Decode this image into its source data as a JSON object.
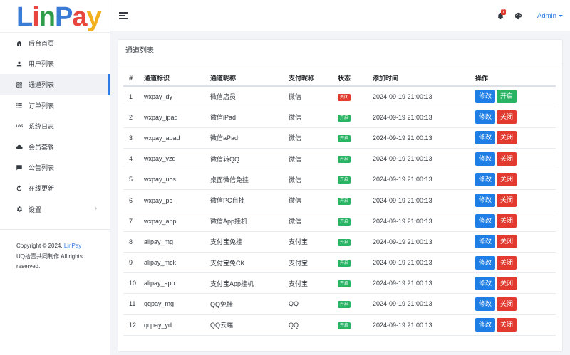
{
  "logo": {
    "letters": [
      "L",
      "i",
      "n",
      "P",
      "a",
      "y"
    ],
    "colors": [
      "#3a7bd5",
      "#e8453c",
      "#2e9e4a",
      "#3a7bd5",
      "#e8453c",
      "#f2b01e"
    ]
  },
  "sidebar": {
    "items": [
      {
        "label": "后台首页",
        "icon": "home-icon"
      },
      {
        "label": "用户列表",
        "icon": "user-icon"
      },
      {
        "label": "通道列表",
        "icon": "qrcode-icon",
        "active": true
      },
      {
        "label": "订单列表",
        "icon": "list-icon"
      },
      {
        "label": "系统日志",
        "icon": "log-icon"
      },
      {
        "label": "会员套餐",
        "icon": "cloud-icon"
      },
      {
        "label": "公告列表",
        "icon": "comment-icon"
      },
      {
        "label": "在线更新",
        "icon": "refresh-icon"
      },
      {
        "label": "设置",
        "icon": "gear-icon",
        "has_caret": true
      }
    ],
    "footer": {
      "copyright": "Copyright © 2024.",
      "brand": "LinPay",
      "line2": "UQ拾壹共同制作 All rights",
      "line3": "reserved."
    }
  },
  "topbar": {
    "notification_count": "7",
    "admin_label": "Admin"
  },
  "card": {
    "title": "通道列表"
  },
  "table": {
    "headers": [
      "#",
      "通道标识",
      "通道昵称",
      "支付昵称",
      "状态",
      "添加时间",
      "操作"
    ],
    "rows": [
      {
        "id": "1",
        "key": "wxpay_dy",
        "name": "微信店员",
        "pay": "微信",
        "status": "关闭",
        "status_on": false,
        "time": "2024-09-19 21:00:13",
        "edit": "修改",
        "toggle": "开启"
      },
      {
        "id": "2",
        "key": "wxpay_ipad",
        "name": "微信iPad",
        "pay": "微信",
        "status": "开启",
        "status_on": true,
        "time": "2024-09-19 21:00:13",
        "edit": "修改",
        "toggle": "关闭"
      },
      {
        "id": "3",
        "key": "wxpay_apad",
        "name": "微信aPad",
        "pay": "微信",
        "status": "开启",
        "status_on": true,
        "time": "2024-09-19 21:00:13",
        "edit": "修改",
        "toggle": "关闭"
      },
      {
        "id": "4",
        "key": "wxpay_vzq",
        "name": "微信转QQ",
        "pay": "微信",
        "status": "开启",
        "status_on": true,
        "time": "2024-09-19 21:00:13",
        "edit": "修改",
        "toggle": "关闭"
      },
      {
        "id": "5",
        "key": "wxpay_uos",
        "name": "桌面微信免挂",
        "pay": "微信",
        "status": "开启",
        "status_on": true,
        "time": "2024-09-19 21:00:13",
        "edit": "修改",
        "toggle": "关闭"
      },
      {
        "id": "6",
        "key": "wxpay_pc",
        "name": "微信PC自挂",
        "pay": "微信",
        "status": "开启",
        "status_on": true,
        "time": "2024-09-19 21:00:13",
        "edit": "修改",
        "toggle": "关闭"
      },
      {
        "id": "7",
        "key": "wxpay_app",
        "name": "微信App挂机",
        "pay": "微信",
        "status": "开启",
        "status_on": true,
        "time": "2024-09-19 21:00:13",
        "edit": "修改",
        "toggle": "关闭"
      },
      {
        "id": "8",
        "key": "alipay_mg",
        "name": "支付宝免挂",
        "pay": "支付宝",
        "status": "开启",
        "status_on": true,
        "time": "2024-09-19 21:00:13",
        "edit": "修改",
        "toggle": "关闭"
      },
      {
        "id": "9",
        "key": "alipay_mck",
        "name": "支付宝免CK",
        "pay": "支付宝",
        "status": "开启",
        "status_on": true,
        "time": "2024-09-19 21:00:13",
        "edit": "修改",
        "toggle": "关闭"
      },
      {
        "id": "10",
        "key": "alipay_app",
        "name": "支付宝App挂机",
        "pay": "支付宝",
        "status": "开启",
        "status_on": true,
        "time": "2024-09-19 21:00:13",
        "edit": "修改",
        "toggle": "关闭"
      },
      {
        "id": "11",
        "key": "qqpay_mg",
        "name": "QQ免挂",
        "pay": "QQ",
        "status": "开启",
        "status_on": true,
        "time": "2024-09-19 21:00:13",
        "edit": "修改",
        "toggle": "关闭"
      },
      {
        "id": "12",
        "key": "qqpay_yd",
        "name": "QQ云端",
        "pay": "QQ",
        "status": "开启",
        "status_on": true,
        "time": "2024-09-19 21:00:13",
        "edit": "修改",
        "toggle": "关闭"
      }
    ]
  },
  "colors": {
    "primary": "#1e7ee6",
    "danger": "#e23a2e",
    "success": "#28b463",
    "accent": "#2d7be5"
  }
}
